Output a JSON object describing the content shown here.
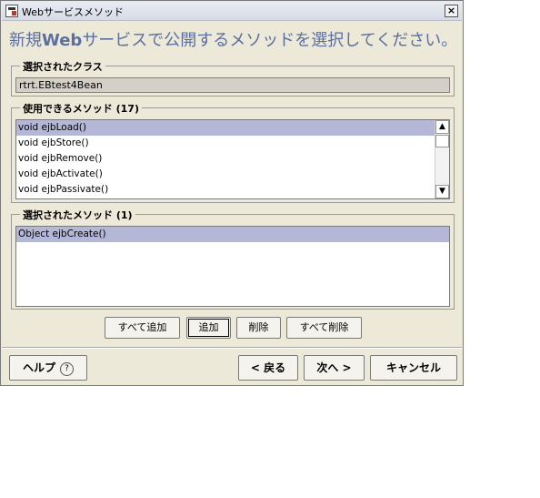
{
  "window": {
    "title": "Webサービスメソッド",
    "close_glyph": "×",
    "icons": [
      "app-icon",
      "close-icon"
    ]
  },
  "heading": {
    "prefix": "新規",
    "bold": "Web",
    "suffix": "サービスで公開するメソッドを選択してください。"
  },
  "selected_class": {
    "label": "選択されたクラス",
    "value": "rtrt.EBtest4Bean"
  },
  "available_methods": {
    "label": "使用できるメソッド (17)",
    "items": [
      "void ejbLoad()",
      "void ejbStore()",
      "void ejbRemove()",
      "void ejbActivate()",
      "void ejbPassivate()"
    ],
    "selected_index": 0,
    "scroll_up_glyph": "▲",
    "scroll_down_glyph": "▼"
  },
  "selected_methods": {
    "label": "選択されたメソッド (1)",
    "items": [
      "Object ejbCreate()"
    ],
    "selected_index": 0
  },
  "actions": {
    "add_all": "すべて追加",
    "add": "追加",
    "remove": "削除",
    "remove_all": "すべて削除"
  },
  "footer": {
    "help": "ヘルプ",
    "help_icon_glyph": "?",
    "back": "< 戻る",
    "next": "次へ >",
    "cancel": "キャンセル"
  },
  "colors": {
    "dialog_bg": "#ECE9D8",
    "heading": "#5b6fa0",
    "selection": "#b4b7d6"
  }
}
